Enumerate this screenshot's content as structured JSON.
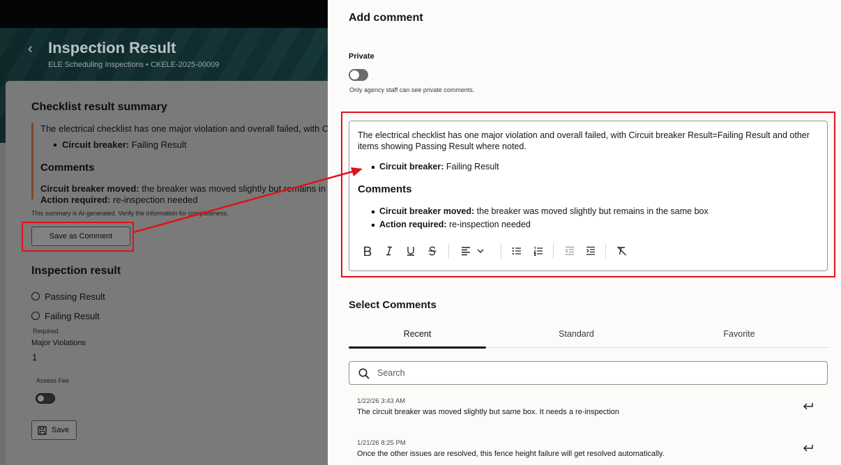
{
  "background": {
    "page_title": "Inspection Result",
    "page_subtitle": "ELE Scheduling Inspections  •  CKELE-2025-00009",
    "summary": {
      "title": "Checklist result summary",
      "paragraph": "The electrical checklist has one major violation and overall failed, with Circu",
      "bullet_label": "Circuit breaker:",
      "bullet_value": " Failing Result",
      "comments_heading": "Comments",
      "comment1_label": "Circuit breaker moved:",
      "comment1_value": " the breaker was moved slightly but remains in the",
      "comment2_label": "Action required:",
      "comment2_value": " re-inspection needed",
      "note": "This summary is AI-generated. Verify the information for completeness."
    },
    "save_as_comment_label": "Save as Comment",
    "inspection_result": {
      "title": "Inspection result",
      "option1": "Passing Result",
      "option2": "Failing Result",
      "required_label": "Required",
      "major_violations_label": "Major Violations",
      "major_violations_value": "1",
      "assess_fee_label": "Assess Fee",
      "save_label": "Save"
    }
  },
  "drawer": {
    "title": "Add comment",
    "private_label": "Private",
    "private_on": false,
    "private_help": "Only agency staff can see private comments.",
    "editor": {
      "paragraph": "The electrical checklist has one major violation and overall failed, with Circuit breaker Result=Failing Result and other items showing Passing Result where noted.",
      "bullet_label": "Circuit breaker:",
      "bullet_value": " Failing Result",
      "heading": "Comments",
      "comment1_label": "Circuit breaker moved:",
      "comment1_value": " the breaker was moved slightly but remains in the same box",
      "comment2_label": "Action required:",
      "comment2_value": " re-inspection needed",
      "toolbar_icons": [
        "bold-icon",
        "italic-icon",
        "underline-icon",
        "strikethrough-icon",
        "align-icon",
        "chevron-down-icon",
        "bulleted-list-icon",
        "numbered-list-icon",
        "outdent-icon",
        "indent-icon",
        "clear-format-icon"
      ]
    },
    "select_comments_title": "Select Comments",
    "tabs": [
      {
        "label": "Recent",
        "active": true
      },
      {
        "label": "Standard",
        "active": false
      },
      {
        "label": "Favorite",
        "active": false
      }
    ],
    "search_placeholder": "Search",
    "comments": [
      {
        "date": "1/22/26 3:43 AM",
        "text": "The circuit breaker was moved slightly but same box. It needs a re-inspection"
      },
      {
        "date": "1/21/26 8:25 PM",
        "text": "Once the other issues are resolved, this fence height failure will get resolved automatically."
      }
    ]
  },
  "colors": {
    "highlight": "#e0121b",
    "overlay": "#6e6e6e",
    "drawer_bg": "#fcfbfa"
  }
}
